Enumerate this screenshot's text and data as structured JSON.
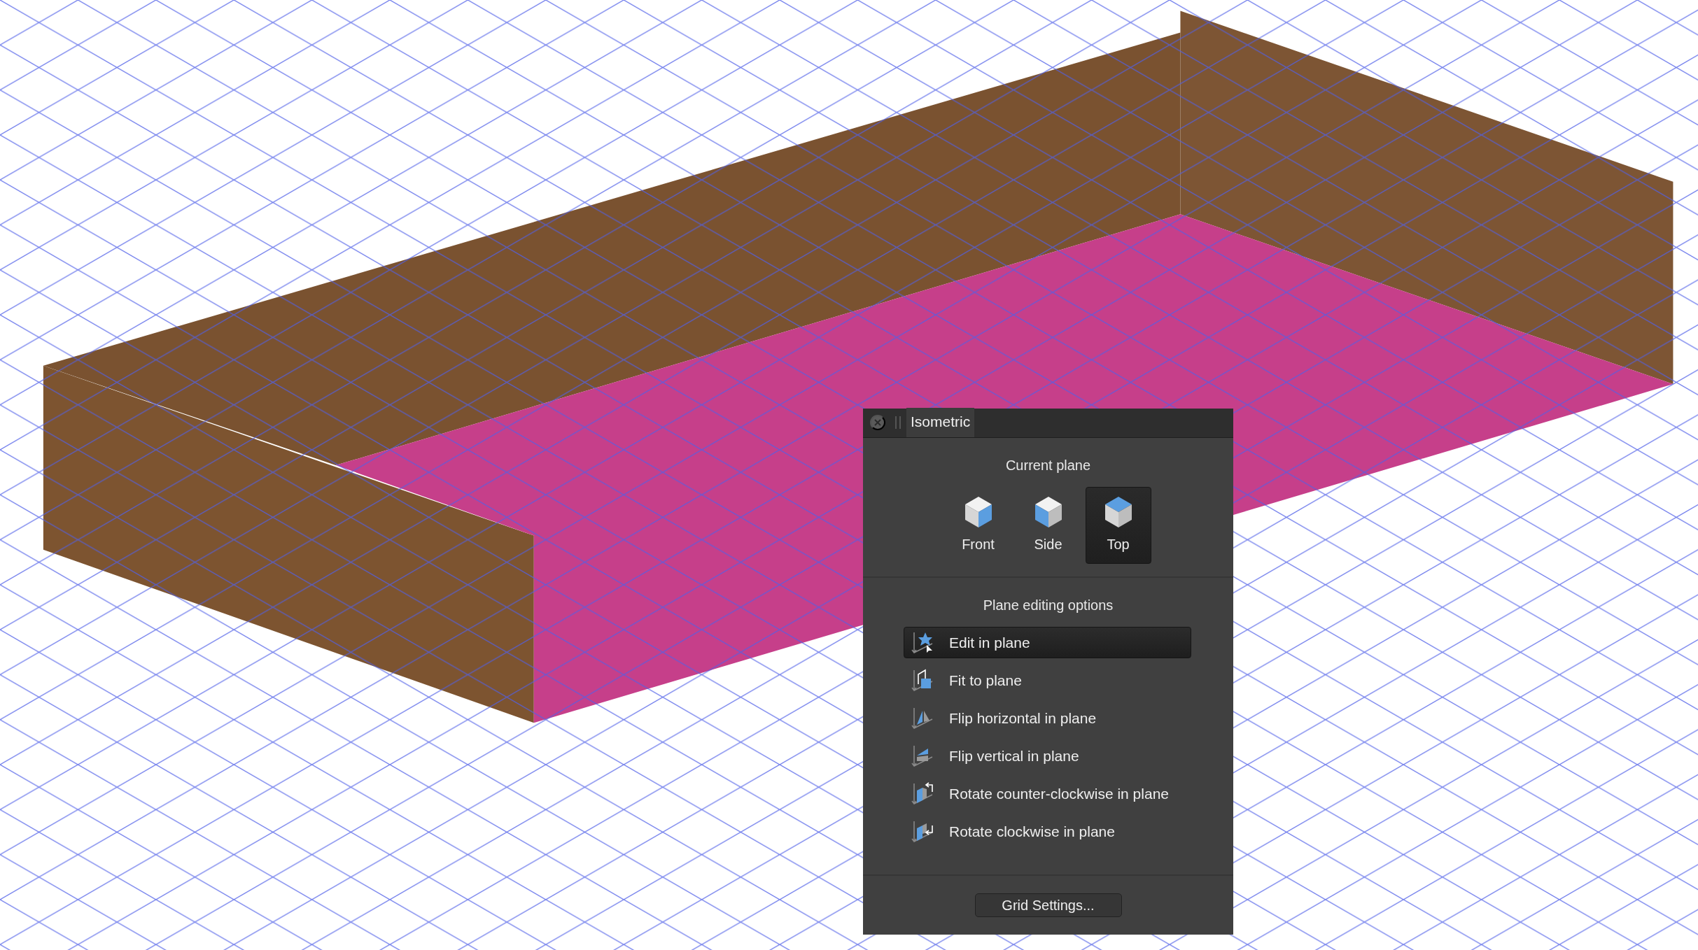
{
  "panel": {
    "tab": "Isometric",
    "plane_heading": "Current plane",
    "planes": [
      {
        "label": "Front",
        "kind": "front",
        "selected": false
      },
      {
        "label": "Side",
        "kind": "side",
        "selected": false
      },
      {
        "label": "Top",
        "kind": "top",
        "selected": true
      }
    ],
    "options_heading": "Plane editing options",
    "options": [
      {
        "label": "Edit in plane",
        "kind": "edit",
        "selected": true
      },
      {
        "label": "Fit to plane",
        "kind": "fit",
        "selected": false
      },
      {
        "label": "Flip horizontal in plane",
        "kind": "flip-h",
        "selected": false
      },
      {
        "label": "Flip vertical in plane",
        "kind": "flip-v",
        "selected": false
      },
      {
        "label": "Rotate counter-clockwise in plane",
        "kind": "rotate-ccw",
        "selected": false
      },
      {
        "label": "Rotate clockwise in plane",
        "kind": "rotate-cw",
        "selected": false
      }
    ],
    "button": "Grid Settings..."
  }
}
